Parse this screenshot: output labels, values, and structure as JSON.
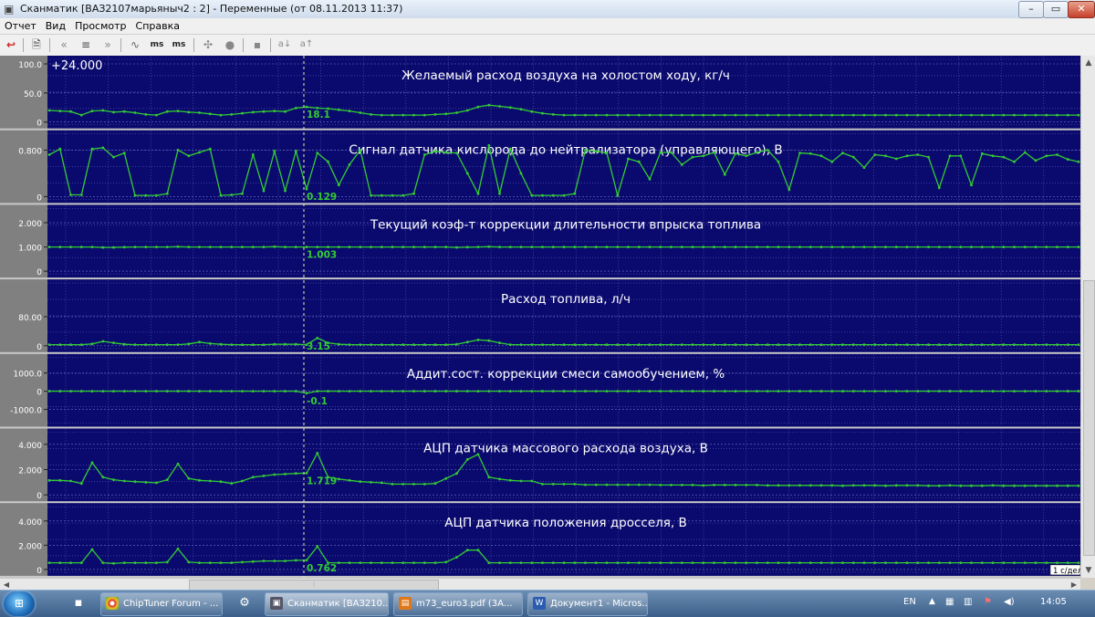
{
  "window": {
    "title": "Сканматик [ВАЗ2107марьяныч2 : 2] - Переменные (от 08.11.2013  11:37)",
    "min_label": "–",
    "max_label": "▭",
    "close_label": "✕"
  },
  "menu": [
    "Отчет",
    "Вид",
    "Просмотр",
    "Справка"
  ],
  "toolbar": {
    "ms_label_1": "ms",
    "ms_label_2": "ms",
    "a_down_label": "a↓",
    "a_up_label": "a↑"
  },
  "cursor_time": "+24.000",
  "time_scale_label": "1 с/дел",
  "colors": {
    "plot_bg": "#0a0a6e",
    "grid": "#5a5ab4",
    "trace": "#33cc33",
    "label_panel": "#808080",
    "cursor": "#e8e8a0"
  },
  "panels": [
    {
      "title": "Желаемый расход воздуха на холостом ходу, кг/ч",
      "axis_labels": [
        "100.0",
        "50.0",
        "0"
      ],
      "axis_min": 0,
      "axis_max": 100,
      "cursor_value": "18.1",
      "values": [
        20,
        19,
        18,
        12,
        19,
        20,
        17,
        18,
        16,
        13,
        12,
        18,
        19,
        17,
        16,
        14,
        12,
        13,
        15,
        17,
        18,
        19,
        18,
        24,
        26,
        24,
        23,
        21,
        19,
        16,
        13,
        12,
        12,
        12,
        12,
        12,
        13,
        14,
        16,
        20,
        26,
        29,
        27,
        25,
        22,
        18,
        15,
        13,
        12,
        12,
        12,
        12,
        12,
        12,
        12,
        12,
        12,
        12,
        12,
        12,
        12,
        12,
        12,
        12,
        12,
        12,
        12,
        12,
        12,
        12,
        12,
        12,
        12,
        12,
        12,
        12,
        12,
        12,
        12,
        12,
        12,
        12,
        12,
        12,
        12,
        12,
        12,
        12,
        12,
        12,
        12,
        12,
        12,
        12,
        12,
        12,
        12
      ]
    },
    {
      "title": "Сигнал датчика кислорода до нейтрализатора (управляющего), В",
      "axis_labels": [
        "0.800",
        "0"
      ],
      "axis_min": 0,
      "axis_max": 1.0,
      "cursor_value": "0.129",
      "values": [
        0.72,
        0.82,
        0.03,
        0.03,
        0.82,
        0.84,
        0.68,
        0.75,
        0.02,
        0.02,
        0.02,
        0.05,
        0.8,
        0.7,
        0.76,
        0.82,
        0.02,
        0.03,
        0.05,
        0.72,
        0.1,
        0.78,
        0.1,
        0.78,
        0.13,
        0.75,
        0.6,
        0.2,
        0.55,
        0.8,
        0.02,
        0.02,
        0.02,
        0.02,
        0.05,
        0.72,
        0.78,
        0.76,
        0.75,
        0.4,
        0.05,
        0.88,
        0.05,
        0.82,
        0.4,
        0.02,
        0.02,
        0.02,
        0.02,
        0.05,
        0.8,
        0.78,
        0.75,
        0.02,
        0.65,
        0.6,
        0.3,
        0.76,
        0.76,
        0.55,
        0.68,
        0.7,
        0.76,
        0.38,
        0.74,
        0.7,
        0.76,
        0.8,
        0.6,
        0.12,
        0.75,
        0.74,
        0.7,
        0.6,
        0.75,
        0.68,
        0.5,
        0.72,
        0.7,
        0.65,
        0.7,
        0.72,
        0.68,
        0.15,
        0.7,
        0.7,
        0.2,
        0.74,
        0.7,
        0.68,
        0.6,
        0.76,
        0.62,
        0.7,
        0.72,
        0.64,
        0.6
      ]
    },
    {
      "title": "Текущий коэф-т коррекции длительности впрыска топлива",
      "axis_labels": [
        "2.000",
        "1.000",
        "0"
      ],
      "axis_min": 0,
      "axis_max": 2.4,
      "cursor_value": "1.003",
      "values": [
        1.0,
        1.0,
        1.0,
        1.0,
        1.0,
        0.98,
        0.98,
        0.99,
        1.0,
        1.0,
        1.0,
        1.0,
        1.01,
        1.0,
        1.0,
        1.0,
        1.0,
        1.0,
        1.0,
        1.0,
        1.0,
        1.01,
        1.0,
        1.0,
        1.0,
        1.0,
        1.0,
        1.0,
        1.0,
        1.0,
        1.0,
        1.0,
        1.0,
        1.0,
        1.0,
        1.0,
        1.0,
        1.0,
        0.98,
        0.99,
        1.0,
        1.01,
        1.0,
        1.0,
        1.0,
        1.0,
        1.0,
        1.0,
        1.0,
        1.0,
        1.0,
        1.0,
        1.0,
        1.0,
        1.0,
        1.0,
        1.0,
        1.0,
        1.0,
        1.0,
        1.0,
        1.0,
        1.0,
        1.0,
        1.0,
        1.0,
        1.0,
        1.0,
        1.0,
        1.0,
        1.0,
        1.0,
        1.0,
        1.0,
        1.0,
        1.0,
        1.0,
        1.0,
        1.0,
        1.0,
        1.0,
        1.0,
        1.0,
        1.0,
        1.0,
        1.0,
        1.0,
        1.0,
        1.0,
        1.0,
        1.0,
        1.0,
        1.0,
        1.0,
        1.0,
        1.0,
        1.0
      ]
    },
    {
      "title": "Расход топлива, л/ч",
      "axis_labels": [
        "80.00",
        "0"
      ],
      "axis_min": 0,
      "axis_max": 160,
      "cursor_value": "3.15",
      "values": [
        3,
        3,
        3,
        3,
        5,
        12,
        8,
        4,
        3,
        3,
        3,
        3,
        3,
        5,
        10,
        6,
        4,
        3,
        3,
        3,
        3,
        4,
        4,
        4,
        3,
        21,
        8,
        4,
        3,
        3,
        3,
        3,
        3,
        3,
        3,
        3,
        3,
        3,
        4,
        10,
        16,
        14,
        8,
        3,
        3,
        3,
        3,
        3,
        3,
        3,
        3,
        3,
        3,
        3,
        3,
        3,
        3,
        3,
        3,
        3,
        3,
        3,
        3,
        3,
        3,
        3,
        3,
        3,
        3,
        3,
        3,
        3,
        3,
        3,
        3,
        3,
        3,
        3,
        3,
        3,
        3,
        3,
        3,
        3,
        3,
        3,
        3,
        3,
        3,
        3,
        3,
        3,
        3,
        3,
        3,
        3,
        3
      ]
    },
    {
      "title": "Аддит.сост. коррекции смеси самообучением, %",
      "axis_labels": [
        "1000.0",
        "0",
        "-1000.0"
      ],
      "axis_min": -1600,
      "axis_max": 1600,
      "cursor_value": "-0.1",
      "values": [
        0,
        0,
        0,
        0,
        0,
        0,
        0,
        0,
        0,
        0,
        0,
        0,
        0,
        0,
        0,
        0,
        0,
        0,
        0,
        0,
        0,
        0,
        0,
        0,
        -110,
        0,
        0,
        0,
        0,
        0,
        0,
        0,
        0,
        0,
        0,
        0,
        0,
        0,
        0,
        0,
        0,
        0,
        0,
        0,
        0,
        0,
        0,
        0,
        0,
        0,
        0,
        0,
        0,
        0,
        0,
        0,
        0,
        0,
        0,
        0,
        0,
        0,
        0,
        0,
        0,
        0,
        0,
        0,
        0,
        0,
        0,
        0,
        0,
        0,
        0,
        0,
        0,
        0,
        0,
        0,
        0,
        0,
        0,
        0,
        0,
        0,
        0,
        0,
        0,
        0,
        0,
        0,
        0,
        0,
        0,
        0,
        0
      ]
    },
    {
      "title": "АЦП датчика массового расхода воздуха, В",
      "axis_labels": [
        "4.000",
        "2.000",
        "0"
      ],
      "axis_min": 0,
      "axis_max": 4.6,
      "cursor_value": "1.719",
      "values": [
        1.15,
        1.15,
        1.1,
        0.9,
        2.55,
        1.4,
        1.2,
        1.1,
        1.05,
        1.0,
        0.95,
        1.2,
        2.45,
        1.3,
        1.15,
        1.1,
        1.05,
        0.9,
        1.1,
        1.4,
        1.5,
        1.6,
        1.65,
        1.7,
        1.72,
        3.3,
        1.4,
        1.25,
        1.15,
        1.05,
        1.0,
        0.95,
        0.85,
        0.85,
        0.85,
        0.85,
        0.9,
        1.3,
        1.7,
        2.8,
        3.2,
        1.4,
        1.25,
        1.15,
        1.1,
        1.1,
        0.85,
        0.85,
        0.85,
        0.85,
        0.8,
        0.8,
        0.8,
        0.8,
        0.8,
        0.8,
        0.8,
        0.78,
        0.78,
        0.78,
        0.78,
        0.75,
        0.78,
        0.78,
        0.78,
        0.78,
        0.78,
        0.75,
        0.75,
        0.75,
        0.75,
        0.75,
        0.75,
        0.75,
        0.72,
        0.75,
        0.75,
        0.75,
        0.72,
        0.75,
        0.75,
        0.75,
        0.72,
        0.72,
        0.75,
        0.72,
        0.72,
        0.72,
        0.75,
        0.72,
        0.72,
        0.72,
        0.72,
        0.72,
        0.72,
        0.72,
        0.72
      ]
    },
    {
      "title": "АЦП датчика положения дросселя, В",
      "axis_labels": [
        "4.000",
        "2.000",
        "0"
      ],
      "axis_min": 0,
      "axis_max": 4.8,
      "cursor_value": "0.762",
      "values": [
        0.55,
        0.55,
        0.55,
        0.55,
        1.65,
        0.55,
        0.5,
        0.55,
        0.55,
        0.55,
        0.55,
        0.6,
        1.7,
        0.6,
        0.55,
        0.55,
        0.55,
        0.55,
        0.6,
        0.65,
        0.7,
        0.7,
        0.7,
        0.75,
        0.76,
        1.9,
        0.55,
        0.55,
        0.55,
        0.55,
        0.55,
        0.55,
        0.55,
        0.55,
        0.55,
        0.55,
        0.55,
        0.6,
        1.0,
        1.6,
        1.6,
        0.55,
        0.55,
        0.55,
        0.55,
        0.55,
        0.55,
        0.55,
        0.55,
        0.55,
        0.55,
        0.55,
        0.55,
        0.55,
        0.55,
        0.55,
        0.55,
        0.55,
        0.55,
        0.55,
        0.55,
        0.55,
        0.55,
        0.55,
        0.55,
        0.55,
        0.55,
        0.55,
        0.55,
        0.55,
        0.55,
        0.55,
        0.55,
        0.55,
        0.55,
        0.55,
        0.55,
        0.55,
        0.55,
        0.55,
        0.55,
        0.55,
        0.55,
        0.55,
        0.55,
        0.55,
        0.55,
        0.55,
        0.55,
        0.55,
        0.55,
        0.55,
        0.55,
        0.55,
        0.55,
        0.55,
        0.55
      ]
    }
  ],
  "taskbar": {
    "items": [
      {
        "label": "ChipTuner Forum - ...",
        "icon": "chrome-icon"
      },
      {
        "label": "Сканматик [ВАЗ210...",
        "icon": "scanmatic-icon"
      },
      {
        "label": "m73_euro3.pdf (3А...",
        "icon": "pdf-icon"
      },
      {
        "label": "Документ1 - Micros...",
        "icon": "word-icon"
      }
    ],
    "lang": "EN",
    "clock": "14:05"
  }
}
